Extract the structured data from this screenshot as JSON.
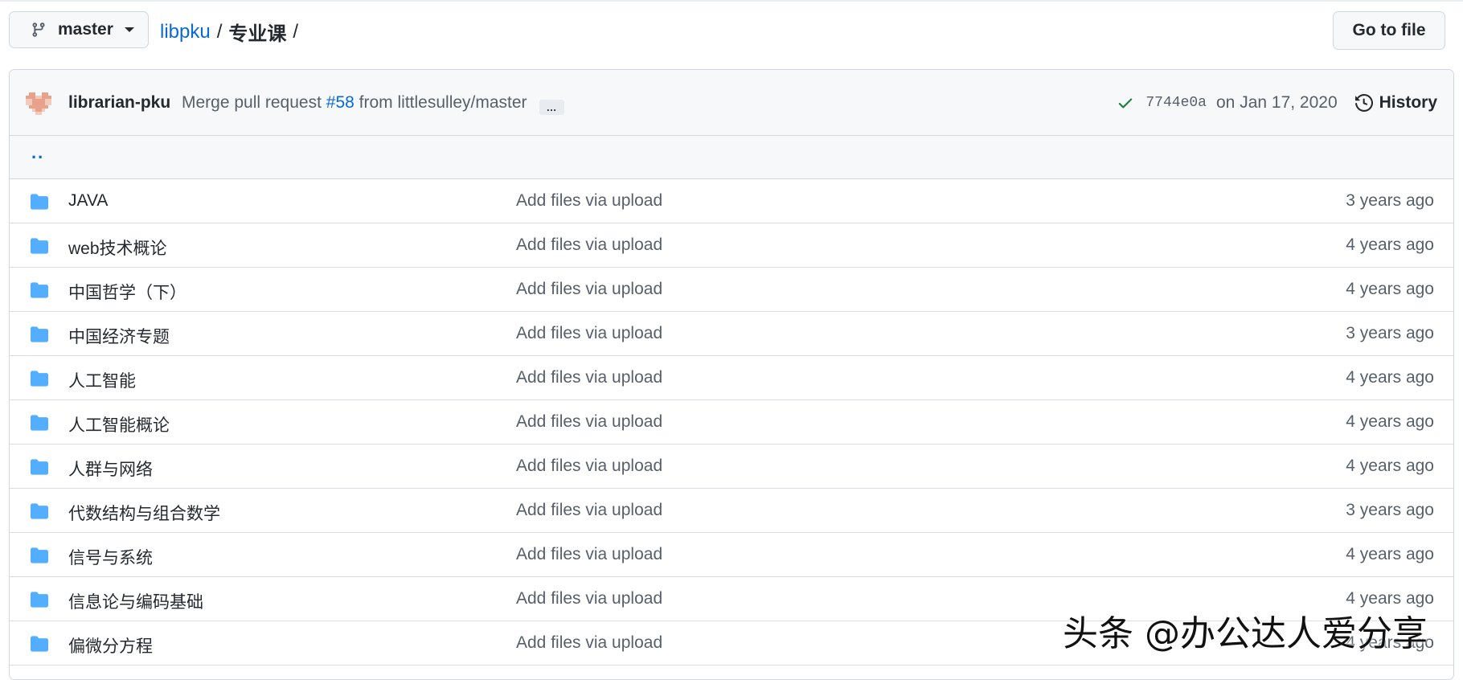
{
  "branch": {
    "label": "master"
  },
  "breadcrumb": {
    "repo": "libpku",
    "sep1": "/",
    "current": "专业课",
    "sep2": "/"
  },
  "goto_file": "Go to file",
  "commit": {
    "author": "librarian-pku",
    "message_prefix": "Merge pull request",
    "pr": "#58",
    "message_suffix": "from littlesulley/master",
    "ellipsis": "…",
    "sha": "7744e0a",
    "date": "on Jan 17, 2020",
    "history": "History",
    "status_color": "#1a7f37"
  },
  "parent_dir": "..",
  "files": [
    {
      "name": "JAVA",
      "message": "Add files via upload",
      "age": "3 years ago",
      "icon": "folder-icon"
    },
    {
      "name": "web技术概论",
      "message": "Add files via upload",
      "age": "4 years ago",
      "icon": "folder-icon"
    },
    {
      "name": "中国哲学（下）",
      "message": "Add files via upload",
      "age": "4 years ago",
      "icon": "folder-icon"
    },
    {
      "name": "中国经济专题",
      "message": "Add files via upload",
      "age": "3 years ago",
      "icon": "folder-icon"
    },
    {
      "name": "人工智能",
      "message": "Add files via upload",
      "age": "4 years ago",
      "icon": "folder-icon"
    },
    {
      "name": "人工智能概论",
      "message": "Add files via upload",
      "age": "4 years ago",
      "icon": "folder-icon"
    },
    {
      "name": "人群与网络",
      "message": "Add files via upload",
      "age": "4 years ago",
      "icon": "folder-icon"
    },
    {
      "name": "代数结构与组合数学",
      "message": "Add files via upload",
      "age": "3 years ago",
      "icon": "folder-icon"
    },
    {
      "name": "信号与系统",
      "message": "Add files via upload",
      "age": "4 years ago",
      "icon": "folder-icon"
    },
    {
      "name": "信息论与编码基础",
      "message": "Add files via upload",
      "age": "4 years ago",
      "icon": "folder-icon"
    },
    {
      "name": "偏微分方程",
      "message": "Add files via upload",
      "age": "4 years ago",
      "icon": "folder-icon"
    }
  ],
  "colors": {
    "link": "#0969da",
    "folder": "#54aeff",
    "muted": "#57606a"
  },
  "watermark": "头条 @办公达人爱分享"
}
